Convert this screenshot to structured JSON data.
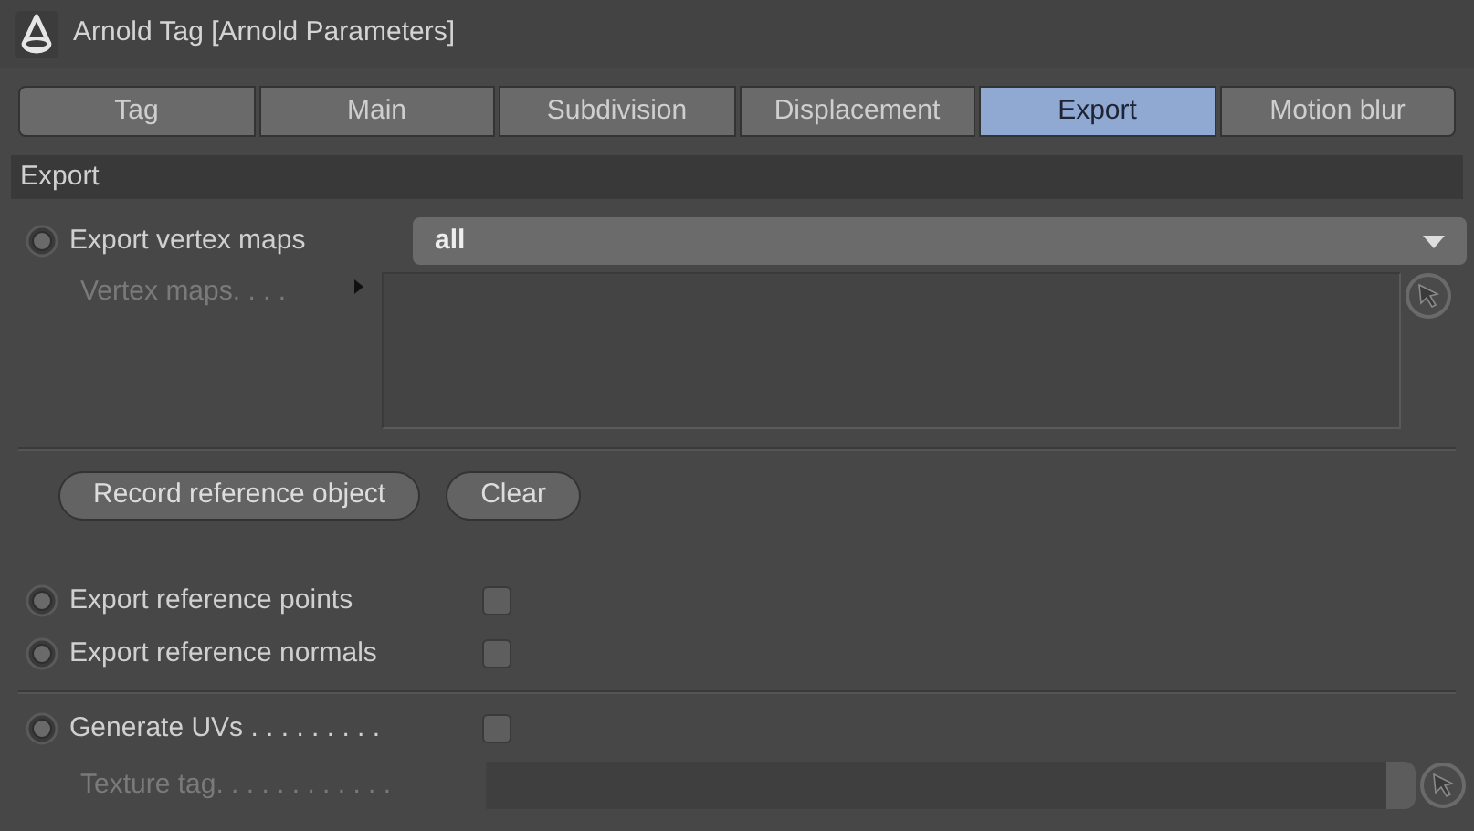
{
  "window": {
    "title": "Arnold Tag [Arnold Parameters]"
  },
  "tabs": [
    {
      "label": "Tag",
      "selected": false
    },
    {
      "label": "Main",
      "selected": false
    },
    {
      "label": "Subdivision",
      "selected": false
    },
    {
      "label": "Displacement",
      "selected": false
    },
    {
      "label": "Export",
      "selected": true
    },
    {
      "label": "Motion blur",
      "selected": false
    }
  ],
  "section": {
    "title": "Export"
  },
  "vertex_export": {
    "label": "Export vertex maps",
    "value": "all"
  },
  "vertex_maps": {
    "label": "Vertex maps. . . .",
    "disabled": true
  },
  "buttons": [
    "Record reference object",
    "Clear"
  ],
  "reference_options": [
    {
      "label": "Export reference points",
      "checked": false
    },
    {
      "label": "Export reference normals",
      "checked": false
    }
  ],
  "generate_uvs": {
    "label": "Generate UVs . . . . . . . . .",
    "checked": false
  },
  "texture_tag": {
    "label": "Texture tag. . . . . . . . . . . .",
    "disabled": true
  }
}
